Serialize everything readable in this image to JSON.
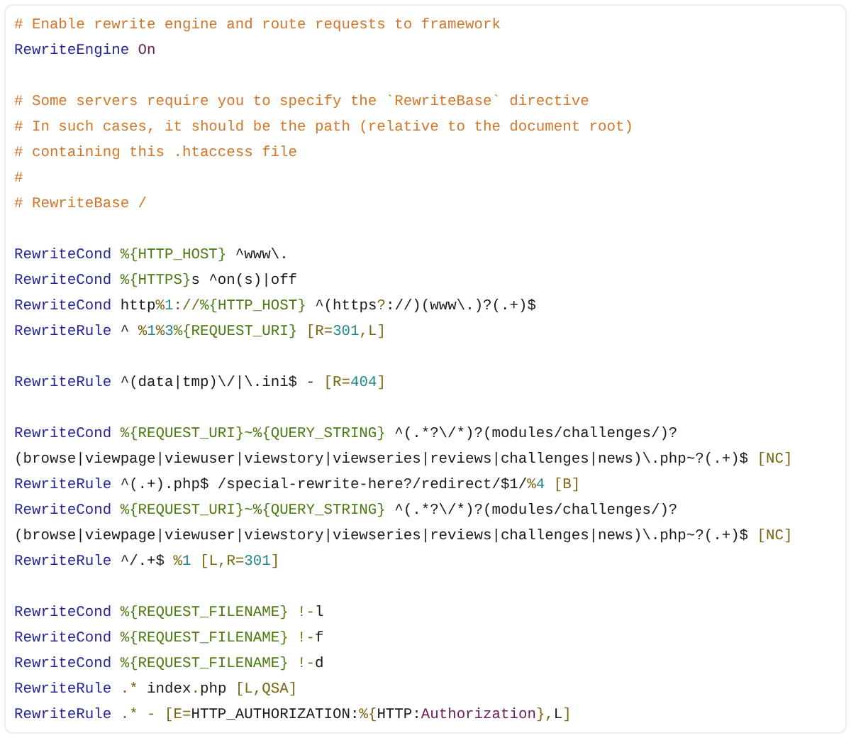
{
  "code_lines": [
    {
      "kind": "code",
      "tokens": [
        {
          "kind": "comment",
          "text": "# Enable rewrite engine and route requests to framework"
        }
      ]
    },
    {
      "kind": "code",
      "tokens": [
        {
          "kind": "directive",
          "text": "RewriteEngine "
        },
        {
          "kind": "keyword",
          "text": "On"
        }
      ]
    },
    {
      "kind": "blank"
    },
    {
      "kind": "code",
      "tokens": [
        {
          "kind": "comment",
          "text": "# Some servers require you to specify the `RewriteBase` directive"
        }
      ]
    },
    {
      "kind": "code",
      "tokens": [
        {
          "kind": "comment",
          "text": "# In such cases, it should be the path (relative to the document root)"
        }
      ]
    },
    {
      "kind": "code",
      "tokens": [
        {
          "kind": "comment",
          "text": "# containing this .htaccess file"
        }
      ]
    },
    {
      "kind": "code",
      "tokens": [
        {
          "kind": "comment",
          "text": "#"
        }
      ]
    },
    {
      "kind": "code",
      "tokens": [
        {
          "kind": "comment",
          "text": "# RewriteBase /"
        }
      ]
    },
    {
      "kind": "blank"
    },
    {
      "kind": "code",
      "tokens": [
        {
          "kind": "directive",
          "text": "RewriteCond "
        },
        {
          "kind": "variable",
          "text": "%{HTTP_HOST}"
        },
        {
          "kind": "text",
          "text": " ^www\\."
        }
      ]
    },
    {
      "kind": "code",
      "tokens": [
        {
          "kind": "directive",
          "text": "RewriteCond "
        },
        {
          "kind": "variable",
          "text": "%{HTTPS}"
        },
        {
          "kind": "text",
          "text": "s ^on(s)|off"
        }
      ]
    },
    {
      "kind": "code",
      "tokens": [
        {
          "kind": "directive",
          "text": "RewriteCond "
        },
        {
          "kind": "text",
          "text": "http"
        },
        {
          "kind": "flag",
          "text": "%"
        },
        {
          "kind": "number",
          "text": "1"
        },
        {
          "kind": "flag",
          "text": "://"
        },
        {
          "kind": "variable",
          "text": "%{HTTP_HOST}"
        },
        {
          "kind": "text",
          "text": " ^(https"
        },
        {
          "kind": "flag",
          "text": "?"
        },
        {
          "kind": "text",
          "text": "://)(www\\.)?(.+)$"
        }
      ]
    },
    {
      "kind": "code",
      "tokens": [
        {
          "kind": "directive",
          "text": "RewriteRule "
        },
        {
          "kind": "text",
          "text": "^ "
        },
        {
          "kind": "flag",
          "text": "%"
        },
        {
          "kind": "number",
          "text": "1"
        },
        {
          "kind": "flag",
          "text": "%"
        },
        {
          "kind": "number",
          "text": "3"
        },
        {
          "kind": "variable",
          "text": "%{REQUEST_URI}"
        },
        {
          "kind": "flag",
          "text": " [R="
        },
        {
          "kind": "number",
          "text": "301"
        },
        {
          "kind": "flag",
          "text": ",L]"
        }
      ]
    },
    {
      "kind": "blank"
    },
    {
      "kind": "code",
      "tokens": [
        {
          "kind": "directive",
          "text": "RewriteRule "
        },
        {
          "kind": "text",
          "text": "^(data|tmp)\\/|\\.ini$ - "
        },
        {
          "kind": "flag",
          "text": "[R="
        },
        {
          "kind": "number",
          "text": "404"
        },
        {
          "kind": "flag",
          "text": "]"
        }
      ]
    },
    {
      "kind": "blank"
    },
    {
      "kind": "code",
      "tokens": [
        {
          "kind": "directive",
          "text": "RewriteCond "
        },
        {
          "kind": "variable",
          "text": "%{REQUEST_URI}~%{QUERY_STRING}"
        },
        {
          "kind": "text",
          "text": " ^(.*?\\/*)?(modules/challenges/)?"
        }
      ]
    },
    {
      "kind": "code",
      "tokens": [
        {
          "kind": "text",
          "text": "(browse|viewpage|viewuser|viewstory|viewseries|reviews|challenges|news)\\.php~?(.+)$ "
        },
        {
          "kind": "flag",
          "text": "[NC]"
        }
      ]
    },
    {
      "kind": "code",
      "tokens": [
        {
          "kind": "directive",
          "text": "RewriteRule "
        },
        {
          "kind": "text",
          "text": "^(.+).php$ /special-rewrite-here?/redirect/$1/"
        },
        {
          "kind": "flag",
          "text": "%"
        },
        {
          "kind": "number",
          "text": "4"
        },
        {
          "kind": "flag",
          "text": " [B]"
        }
      ]
    },
    {
      "kind": "code",
      "tokens": [
        {
          "kind": "directive",
          "text": "RewriteCond "
        },
        {
          "kind": "variable",
          "text": "%{REQUEST_URI}~%{QUERY_STRING}"
        },
        {
          "kind": "text",
          "text": " ^(.*?\\/*)?(modules/challenges/)?"
        }
      ]
    },
    {
      "kind": "code",
      "tokens": [
        {
          "kind": "text",
          "text": "(browse|viewpage|viewuser|viewstory|viewseries|reviews|challenges|news)\\.php~?(.+)$ "
        },
        {
          "kind": "flag",
          "text": "[NC]"
        }
      ]
    },
    {
      "kind": "code",
      "tokens": [
        {
          "kind": "directive",
          "text": "RewriteRule "
        },
        {
          "kind": "text",
          "text": "^/.+$ "
        },
        {
          "kind": "flag",
          "text": "%"
        },
        {
          "kind": "number",
          "text": "1"
        },
        {
          "kind": "flag",
          "text": " [L,R="
        },
        {
          "kind": "number",
          "text": "301"
        },
        {
          "kind": "flag",
          "text": "]"
        }
      ]
    },
    {
      "kind": "blank"
    },
    {
      "kind": "code",
      "tokens": [
        {
          "kind": "directive",
          "text": "RewriteCond "
        },
        {
          "kind": "variable",
          "text": "%{REQUEST_FILENAME}"
        },
        {
          "kind": "flag",
          "text": " !-"
        },
        {
          "kind": "text",
          "text": "l"
        }
      ]
    },
    {
      "kind": "code",
      "tokens": [
        {
          "kind": "directive",
          "text": "RewriteCond "
        },
        {
          "kind": "variable",
          "text": "%{REQUEST_FILENAME}"
        },
        {
          "kind": "flag",
          "text": " !-"
        },
        {
          "kind": "text",
          "text": "f"
        }
      ]
    },
    {
      "kind": "code",
      "tokens": [
        {
          "kind": "directive",
          "text": "RewriteCond "
        },
        {
          "kind": "variable",
          "text": "%{REQUEST_FILENAME}"
        },
        {
          "kind": "flag",
          "text": " !-"
        },
        {
          "kind": "text",
          "text": "d"
        }
      ]
    },
    {
      "kind": "code",
      "tokens": [
        {
          "kind": "directive",
          "text": "RewriteRule "
        },
        {
          "kind": "flag",
          "text": ".*"
        },
        {
          "kind": "text",
          "text": " index"
        },
        {
          "kind": "flag",
          "text": "."
        },
        {
          "kind": "text",
          "text": "php "
        },
        {
          "kind": "flag",
          "text": "[L,QSA]"
        }
      ]
    },
    {
      "kind": "code",
      "tokens": [
        {
          "kind": "directive",
          "text": "RewriteRule "
        },
        {
          "kind": "flag",
          "text": ".* - [E="
        },
        {
          "kind": "text",
          "text": "HTTP_AUTHORIZATION:"
        },
        {
          "kind": "flag",
          "text": "%{"
        },
        {
          "kind": "text",
          "text": "HTTP:"
        },
        {
          "kind": "keyword",
          "text": "Authorization"
        },
        {
          "kind": "flag",
          "text": "},"
        },
        {
          "kind": "text",
          "text": "L"
        },
        {
          "kind": "flag",
          "text": "]"
        }
      ]
    }
  ]
}
